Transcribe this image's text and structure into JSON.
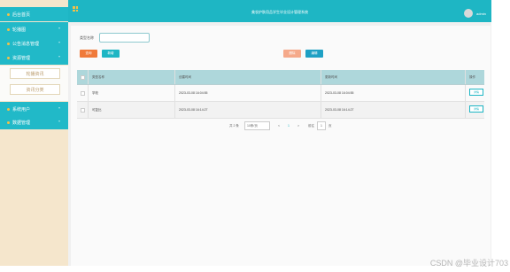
{
  "header": {
    "title": "美妆护肤用品学生毕业设计管理系统",
    "username": "admin"
  },
  "sidebar": {
    "items": [
      {
        "label": "后台首页"
      },
      {
        "label": "轮播图"
      },
      {
        "label": "公告消息管理"
      },
      {
        "label": "资源管理"
      },
      {
        "label": "系统用户"
      },
      {
        "label": "数据管理"
      }
    ],
    "submenu": [
      {
        "label": "轮播资讯"
      },
      {
        "label": "资讯分类"
      }
    ]
  },
  "filter": {
    "label": "类型名称",
    "input_value": "",
    "query_label": "查询",
    "add_label": "新增",
    "delete_label": "删除",
    "edit_label": "编辑"
  },
  "table": {
    "columns": [
      "类型名称",
      "创建时间",
      "更新时间",
      "操作"
    ],
    "rows": [
      {
        "name": "学校",
        "created": "2023-03-08 16:04:55",
        "updated": "2023-03-08 16:04:55",
        "action": "详情"
      },
      {
        "name": "可复比",
        "created": "2023-03-08 16:14:27",
        "updated": "2023-03-08 16:14:27",
        "action": "详情"
      }
    ]
  },
  "pagination": {
    "total": "共 2 条",
    "page_size": "10条/页",
    "prev": "<",
    "page": "1",
    "next": ">",
    "goto_label": "前往",
    "goto_value": "1",
    "page_suffix": "页"
  },
  "watermark": "CSDN @毕业设计703",
  "colors": {
    "primary": "#1eb6c4",
    "sidebar_bg": "#f5e6cc",
    "accent_orange": "#f07a3a"
  }
}
